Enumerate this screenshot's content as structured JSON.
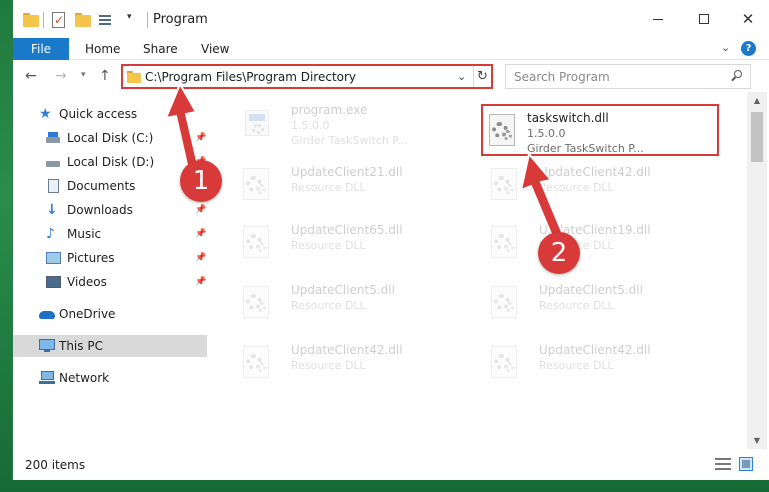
{
  "window": {
    "title": "Program"
  },
  "ribbon": {
    "tabs": [
      "File",
      "Home",
      "Share",
      "View"
    ]
  },
  "address_bar": {
    "path": "C:\\Program Files\\Program Directory",
    "search_placeholder": "Search Program"
  },
  "sidebar": {
    "items": [
      {
        "label": "Quick access",
        "icon": "star-icon"
      },
      {
        "label": "Local Disk (C:)",
        "icon": "drive-icon",
        "pinned": true
      },
      {
        "label": "Local Disk (D:)",
        "icon": "drive-icon",
        "pinned": true
      },
      {
        "label": "Documents",
        "icon": "documents-icon",
        "pinned": true
      },
      {
        "label": "Downloads",
        "icon": "download-icon",
        "pinned": true
      },
      {
        "label": "Music",
        "icon": "music-icon",
        "pinned": true
      },
      {
        "label": "Pictures",
        "icon": "pictures-icon",
        "pinned": true
      },
      {
        "label": "Videos",
        "icon": "videos-icon",
        "pinned": true
      },
      {
        "label": "OneDrive",
        "icon": "cloud-icon"
      },
      {
        "label": "This PC",
        "icon": "computer-icon",
        "selected": true
      },
      {
        "label": "Network",
        "icon": "network-icon"
      }
    ]
  },
  "files": [
    {
      "name": "program.exe",
      "line1": "1.5.0.0",
      "line2": "Girder TaskSwitch P...",
      "icon": "exe-icon",
      "faded": true
    },
    {
      "name": "taskswitch.dll",
      "line1": "1.5.0.0",
      "line2": "Girder TaskSwitch P...",
      "icon": "dll-gear-icon",
      "highlighted": true
    },
    {
      "name": "UpdateClient21.dll",
      "line1": "Resource DLL",
      "icon": "dll-gear-icon",
      "faded": true
    },
    {
      "name": "UpdateClient42.dll",
      "line1": "Resource DLL",
      "icon": "dll-gear-icon",
      "faded": true
    },
    {
      "name": "UpdateClient65.dll",
      "line1": "Resource DLL",
      "icon": "dll-gear-icon",
      "faded": true
    },
    {
      "name": "UpdateClient19.dll",
      "line1": "Resource DLL",
      "icon": "dll-gear-icon",
      "faded": true
    },
    {
      "name": "UpdateClient5.dll",
      "line1": "Resource DLL",
      "icon": "dll-gear-icon",
      "faded": true
    },
    {
      "name": "UpdateClient5.dll",
      "line1": "Resource DLL",
      "icon": "dll-gear-icon",
      "faded": true
    },
    {
      "name": "UpdateClient42.dll",
      "line1": "Resource DLL",
      "icon": "dll-gear-icon",
      "faded": true
    },
    {
      "name": "UpdateClient42.dll",
      "line1": "Resource DLL",
      "icon": "dll-gear-icon",
      "faded": true
    }
  ],
  "status": {
    "item_count": "200 items"
  },
  "annotations": {
    "step1": "1",
    "step2": "2"
  },
  "colors": {
    "accent": "#1979ca",
    "highlight": "#d83a3a"
  }
}
